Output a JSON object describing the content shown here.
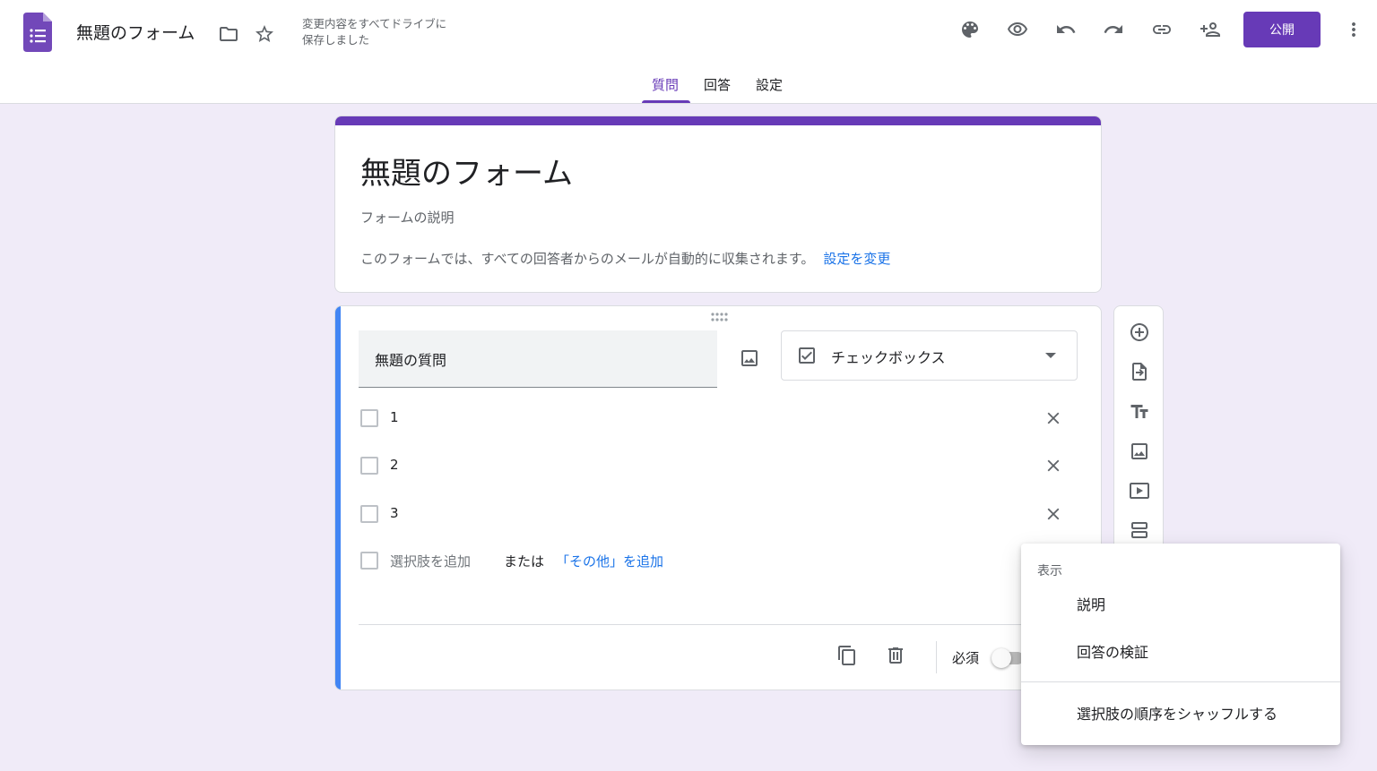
{
  "header": {
    "doc_title": "無題のフォーム",
    "save_status_line1": "変更内容をすべてドライブに",
    "save_status_line2": "保存しました",
    "publish_label": "公開"
  },
  "tabs": [
    {
      "label": "質問",
      "active": true
    },
    {
      "label": "回答",
      "active": false
    },
    {
      "label": "設定",
      "active": false
    }
  ],
  "title_card": {
    "title": "無題のフォーム",
    "description_placeholder": "フォームの説明",
    "email_note": "このフォームでは、すべての回答者からのメールが自動的に収集されます。",
    "change_settings_link": "設定を変更"
  },
  "question": {
    "title": "無題の質問",
    "type_label": "チェックボックス",
    "options": [
      {
        "label": "1"
      },
      {
        "label": "2"
      },
      {
        "label": "3"
      }
    ],
    "add_option": "選択肢を追加",
    "or": "または",
    "add_other": "「その他」を追加",
    "required_label": "必須",
    "required": false
  },
  "menu": {
    "header": "表示",
    "items": [
      {
        "label": "説明"
      },
      {
        "label": "回答の検証"
      },
      {
        "label": "選択肢の順序をシャッフルする"
      }
    ]
  },
  "colors": {
    "accent": "#673ab7",
    "background": "#f0ebf8",
    "active_question_bar": "#4285f4",
    "link": "#1a73e8"
  },
  "icons": {
    "header": [
      "forms-logo-icon",
      "folder-icon",
      "star-icon",
      "palette-icon",
      "preview-eye-icon",
      "undo-icon",
      "redo-icon",
      "link-icon",
      "add-collaborator-icon",
      "more-vert-icon"
    ],
    "side_toolbar": [
      "add-question-icon",
      "import-questions-icon",
      "add-title-icon",
      "add-image-icon",
      "add-video-icon",
      "add-section-icon"
    ],
    "question_footer": [
      "duplicate-icon",
      "delete-icon"
    ]
  }
}
